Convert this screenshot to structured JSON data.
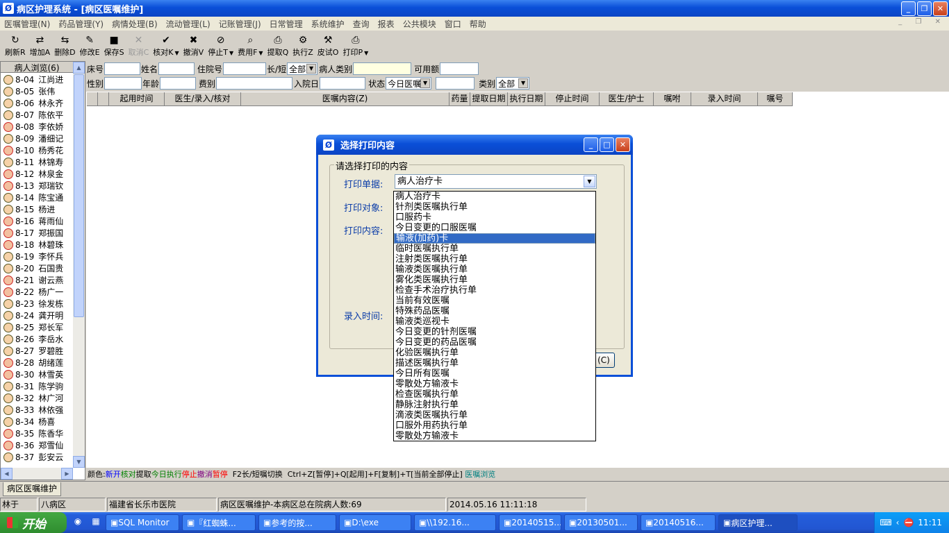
{
  "window": {
    "title": "病区护理系统 - [病区医嘱维护]",
    "minimize": "_",
    "restore": "❐",
    "close": "✕"
  },
  "menu": [
    "医嘱管理(N)",
    "药品管理(Y)",
    "病情处理(B)",
    "流动管理(L)",
    "记账管理(J)",
    "日常管理",
    "系统维护",
    "查询",
    "报表",
    "公共模块",
    "窗口",
    "帮助"
  ],
  "toolbar": [
    {
      "label": "刷新R",
      "icon": "↻",
      "enabled": true
    },
    {
      "label": "增加A",
      "icon": "⇄",
      "enabled": true
    },
    {
      "label": "删除D",
      "icon": "⇆",
      "enabled": true
    },
    {
      "label": "修改E",
      "icon": "✎",
      "enabled": true
    },
    {
      "label": "保存S",
      "icon": "■",
      "enabled": true
    },
    {
      "label": "取消C",
      "icon": "✕",
      "enabled": false
    },
    {
      "label": "核对K",
      "icon": "✔",
      "enabled": true,
      "dropdown": true
    },
    {
      "label": "撤消V",
      "icon": "✖",
      "enabled": true
    },
    {
      "label": "停止T",
      "icon": "⊘",
      "enabled": true,
      "dropdown": true
    },
    {
      "label": "费用F",
      "icon": "⌕",
      "enabled": true,
      "dropdown": true
    },
    {
      "label": "提取Q",
      "icon": "⎙",
      "enabled": true
    },
    {
      "label": "执行Z",
      "icon": "⚙",
      "enabled": true
    },
    {
      "label": "皮试O",
      "icon": "⚒",
      "enabled": true
    },
    {
      "label": "打印P",
      "icon": "⎙",
      "enabled": true,
      "dropdown": true
    }
  ],
  "patient_panel": {
    "header": "病人浏览(6)",
    "patients": [
      {
        "bed": "8-04",
        "name": "江尚进",
        "f": false
      },
      {
        "bed": "8-05",
        "name": "张伟",
        "f": false
      },
      {
        "bed": "8-06",
        "name": "林永齐",
        "f": false
      },
      {
        "bed": "8-07",
        "name": "陈依平",
        "f": false
      },
      {
        "bed": "8-08",
        "name": "李依娇",
        "f": true
      },
      {
        "bed": "8-09",
        "name": "潘细记",
        "f": false
      },
      {
        "bed": "8-10",
        "name": "杨秀花",
        "f": true
      },
      {
        "bed": "8-11",
        "name": "林锦寿",
        "f": false
      },
      {
        "bed": "8-12",
        "name": "林泉金",
        "f": true
      },
      {
        "bed": "8-13",
        "name": "郑瑞钦",
        "f": true
      },
      {
        "bed": "8-14",
        "name": "陈宝通",
        "f": false
      },
      {
        "bed": "8-15",
        "name": "杨进",
        "f": false
      },
      {
        "bed": "8-16",
        "name": "蒋雨仙",
        "f": true
      },
      {
        "bed": "8-17",
        "name": "郑振国",
        "f": true
      },
      {
        "bed": "8-18",
        "name": "林碧珠",
        "f": true
      },
      {
        "bed": "8-19",
        "name": "李怀兵",
        "f": false
      },
      {
        "bed": "8-20",
        "name": "石国贵",
        "f": false
      },
      {
        "bed": "8-21",
        "name": "谢云燕",
        "f": true
      },
      {
        "bed": "8-22",
        "name": "杨广一",
        "f": true
      },
      {
        "bed": "8-23",
        "name": "徐发栋",
        "f": false
      },
      {
        "bed": "8-24",
        "name": "龚开明",
        "f": false
      },
      {
        "bed": "8-25",
        "name": "郑长军",
        "f": false
      },
      {
        "bed": "8-26",
        "name": "李岳水",
        "f": false
      },
      {
        "bed": "8-27",
        "name": "罗碧胜",
        "f": false
      },
      {
        "bed": "8-28",
        "name": "胡绪莲",
        "f": true
      },
      {
        "bed": "8-30",
        "name": "林雪英",
        "f": true
      },
      {
        "bed": "8-31",
        "name": "陈学驹",
        "f": false
      },
      {
        "bed": "8-32",
        "name": "林广河",
        "f": false
      },
      {
        "bed": "8-33",
        "name": "林依强",
        "f": false
      },
      {
        "bed": "8-34",
        "name": "杨喜",
        "f": false
      },
      {
        "bed": "8-35",
        "name": "陈香华",
        "f": true
      },
      {
        "bed": "8-36",
        "name": "郑雪仙",
        "f": true
      },
      {
        "bed": "8-37",
        "name": "彭安云",
        "f": false
      }
    ]
  },
  "form": {
    "bed_label": "床号",
    "name_label": "姓名",
    "admission_no_label": "住院号",
    "term_label": "长/短",
    "term_value": "全部",
    "patient_type_label": "病人类别",
    "available_label": "可用额",
    "sex_label": "性别",
    "age_label": "年龄",
    "fee_label": "费别",
    "admit_date_label": "入院日",
    "status_label": "状态",
    "status_value": "今日医嘱",
    "category_label": "类别",
    "category_value": "全部"
  },
  "grid_headers": [
    "",
    "",
    "起用时间",
    "医生/录入/核对",
    "医嘱内容(Z)",
    "药量",
    "提取日期",
    "执行日期",
    "停止时间",
    "医生/护士",
    "嘱咐",
    "录入时间",
    "嘱号"
  ],
  "legend": [
    {
      "text": "颜色:",
      "color": "#000000"
    },
    {
      "text": "新开",
      "color": "#0000ff"
    },
    {
      "text": "核对",
      "color": "#008000"
    },
    {
      "text": "提取",
      "color": "#000000"
    },
    {
      "text": "今日执行",
      "color": "#008000"
    },
    {
      "text": "停止",
      "color": "#ff0000"
    },
    {
      "text": "撤消",
      "color": "#800080"
    },
    {
      "text": "暂停",
      "color": "#ff0000"
    },
    {
      "text": "  F2长/短嘱切换  Ctrl+Z[暂停]+Q[起用]+F[复制]+T[当前全部停止] ",
      "color": "#000000"
    },
    {
      "text": "医嘱浏览",
      "color": "#008080"
    }
  ],
  "tab": "病区医嘱维护",
  "status": [
    "林于",
    "八病区",
    "福建省长乐市医院",
    "病区医嘱维护-本病区总在院病人数:69",
    "2014.05.16 11:11:18"
  ],
  "dialog": {
    "title": "选择打印内容",
    "group_title": "请选择打印的内容",
    "doc_label": "打印单据:",
    "target_label": "打印对象:",
    "content_label": "打印内容:",
    "time_label": "录入时间:",
    "selected_doc": "病人治疗卡",
    "cancel_btn": "(C)",
    "options": [
      "病人治疗卡",
      "针剂类医嘱执行单",
      "口服药卡",
      "今日变更的口服医嘱",
      "输液(加药)卡",
      "临时医嘱执行单",
      "注射类医嘱执行单",
      "输液类医嘱执行单",
      "雾化类医嘱执行单",
      "检查手术治疗执行单",
      "当前有效医嘱",
      "特殊药品医嘱",
      "输液类巡视卡",
      "今日变更的针剂医嘱",
      "今日变更的药品医嘱",
      "化验医嘱执行单",
      "描述医嘱执行单",
      "今日所有医嘱",
      "零散处方输液卡",
      "检查医嘱执行单",
      "静脉注射执行单",
      "滴液类医嘱执行单",
      "口服外用药执行单",
      "零散处方输液卡"
    ],
    "highlighted_index": 4
  },
  "taskbar": {
    "start": "开始",
    "tasks": [
      "SQL Monitor",
      "『红蜘蛛...",
      "参考的按...",
      "D:\\exe",
      "\\\\192.16...",
      "20140515...",
      "20130501...",
      "20140516...",
      "病区护理..."
    ],
    "time": "11:11"
  }
}
